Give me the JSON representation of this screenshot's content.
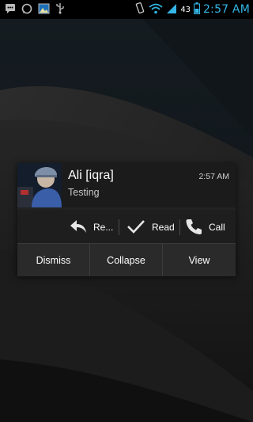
{
  "statusbar": {
    "left_icons": [
      "chat-icon",
      "whatsapp-icon",
      "gallery-icon",
      "usb-icon"
    ],
    "battery_level": "43",
    "clock": "2:57 AM",
    "accent_color": "#33b5e5"
  },
  "popup": {
    "sender": "Ali [iqra]",
    "message": "Testing",
    "time": "2:57 AM",
    "actions": {
      "reply_label": "Re...",
      "read_label": "Read",
      "call_label": "Call"
    },
    "buttons": {
      "dismiss_label": "Dismiss",
      "collapse_label": "Collapse",
      "view_label": "View"
    }
  }
}
